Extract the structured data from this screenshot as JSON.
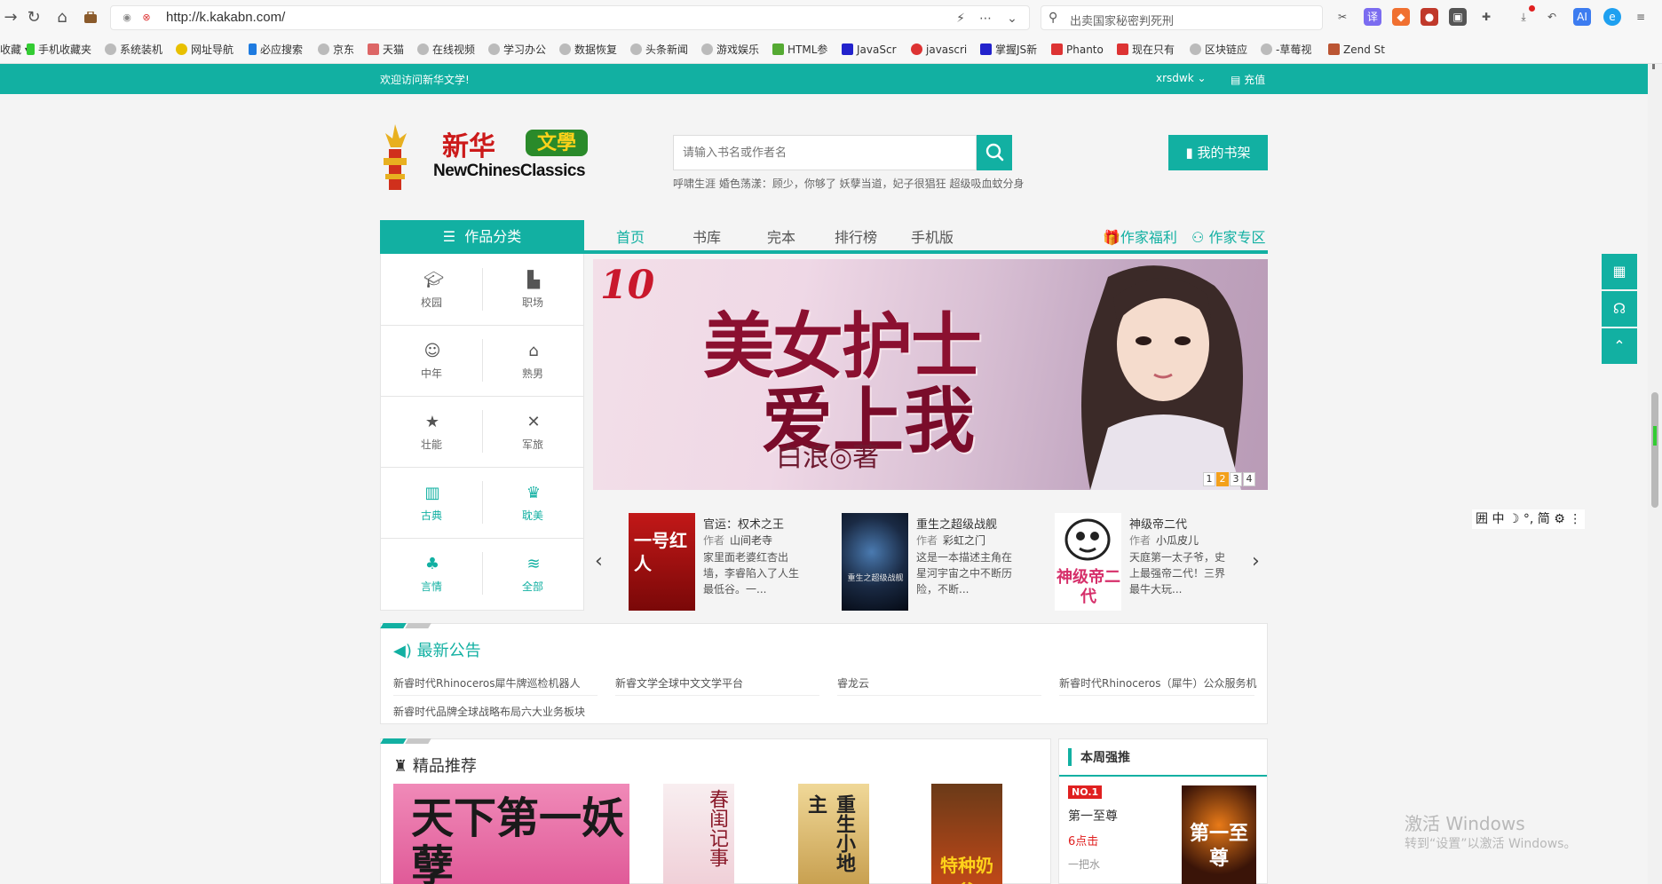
{
  "browser": {
    "url": "http://k.kakabn.com/",
    "search_text": "出卖国家秘密判死刑",
    "bookmarks": [
      "收藏",
      "手机收藏夹",
      "系统装机",
      "网址导航",
      "必应搜索",
      "京东",
      "天猫",
      "在线视频",
      "学习办公",
      "数据恢复",
      "头条新闻",
      "游戏娱乐",
      "HTML参",
      "JavaScr",
      "javascri",
      "掌握JS新",
      "Phanto",
      "现在只有",
      "区块链应",
      "-草莓视",
      "Zend St"
    ]
  },
  "site": {
    "welcome": "欢迎访问新华文学!",
    "username": "xrsdwk",
    "recharge": "充值",
    "logo_cn": "新华",
    "logo_badge": "文學",
    "logo_en": "NewChinesClassics",
    "search_placeholder": "请输入书名或作者名",
    "hot_words": "呼啸生涯  婚色荡漾：顾少，你够了  妖孽当道，妃子很猖狂  超级吸血蚊分身",
    "shelf_btn": "我的书架",
    "category_head": "作品分类",
    "nav": [
      "首页",
      "书库",
      "完本",
      "排行榜",
      "手机版"
    ],
    "nav_right": [
      "作家福利",
      "作家专区"
    ]
  },
  "categories": [
    {
      "label": "校园",
      "icon": "graduation-cap-icon"
    },
    {
      "label": "职场",
      "icon": "city-icon"
    },
    {
      "label": "中年",
      "icon": "user-icon"
    },
    {
      "label": "熟男",
      "icon": "home-icon"
    },
    {
      "label": "壮能",
      "icon": "star-icon"
    },
    {
      "label": "军旅",
      "icon": "crossed-swords-icon"
    },
    {
      "label": "古典",
      "icon": "fortress-icon"
    },
    {
      "label": "耽美",
      "icon": "crown-icon"
    },
    {
      "label": "言情",
      "icon": "clover-icon"
    },
    {
      "label": "全部",
      "icon": "layers-icon"
    }
  ],
  "banner": {
    "title_line1": "美女护士",
    "title_line2": "爱上我",
    "author": "白浪◎著",
    "pages": [
      "1",
      "2",
      "3",
      "4"
    ],
    "active_page": "2"
  },
  "featured": [
    {
      "title": "官运：权术之王",
      "author_label": "作者",
      "author": "山间老寺",
      "desc": "家里面老婆红杏出墙，李睿陷入了人生最低谷。一...",
      "cover_text": "一号红人"
    },
    {
      "title": "重生之超级战舰",
      "author_label": "作者",
      "author": "彩虹之门",
      "desc": "这是一本描述主角在星河宇宙之中不断历险，不断...",
      "cover_text": "重生之超级战舰"
    },
    {
      "title": "神级帝二代",
      "author_label": "作者",
      "author": "小瓜皮儿",
      "desc": "天庭第一太子爷，史上最强帝二代！三界最牛大玩...",
      "cover_text": "神级帝二代"
    }
  ],
  "notice": {
    "title": "最新公告",
    "items": [
      "新睿时代Rhinoceros犀牛牌巡检机器人",
      "新睿文学全球中文文学平台",
      "睿龙云",
      "新睿时代Rhinoceros（犀牛）公众服务机",
      "新睿时代品牌全球战略布局六大业务板块"
    ]
  },
  "recommend": {
    "title": "精品推荐",
    "covers": [
      "天下第一妖孽",
      "春闺记事",
      "重生小地主",
      "特种奶爸"
    ]
  },
  "weekly": {
    "title": "本周强推",
    "rank": "NO.1",
    "book": "第一至尊",
    "clicks": "6点击",
    "author": "一把水",
    "cover_text": "第一至尊"
  },
  "ime": "囲 中 ☽ °, 简 ⚙ ⋮",
  "watermark": {
    "line1": "激活 Windows",
    "line2": "转到“设置”以激活 Windows。"
  },
  "colors": {
    "accent": "#12b0a2",
    "badge_red": "#e02020",
    "active_page": "#f3a01b"
  }
}
